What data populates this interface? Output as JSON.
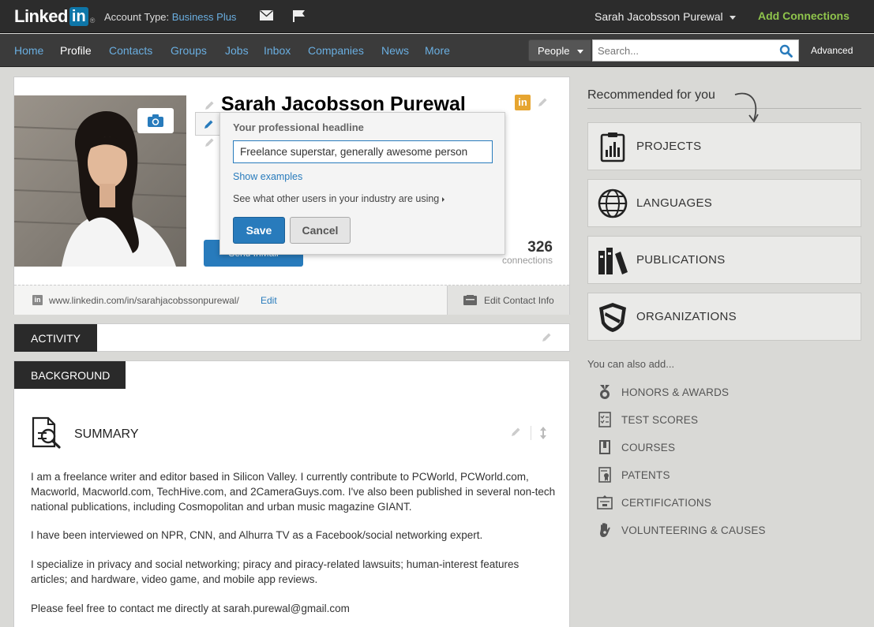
{
  "colors": {
    "link": "#287bbc",
    "nav_link": "#6aaee0",
    "add_connections": "#8fc44c",
    "topbar": "#2c2c2c"
  },
  "topbar": {
    "logo_text": "Linked",
    "logo_in": "in",
    "logo_reg": "®",
    "account_type_label": "Account Type:",
    "account_type_value": "Business Plus",
    "user_name": "Sarah Jacobsson Purewal",
    "add_connections": "Add Connections"
  },
  "nav": {
    "items": [
      "Home",
      "Profile",
      "Contacts",
      "Groups",
      "Jobs",
      "Inbox",
      "Companies",
      "News",
      "More"
    ],
    "active": "Profile",
    "search_scope": "People",
    "search_placeholder": "Search...",
    "advanced": "Advanced"
  },
  "profile": {
    "name": "Sarah Jacobsson Purewal",
    "li_badge": "in",
    "send_button": "Send InMail",
    "connections_count": "326",
    "connections_label": "connections",
    "public_url": "www.linkedin.com/in/sarahjacobssonpurewal/",
    "url_edit": "Edit",
    "edit_contact": "Edit Contact Info"
  },
  "headline_popover": {
    "title": "Your professional headline",
    "value": "Freelance superstar, generally awesome person",
    "show_examples": "Show examples",
    "others_link": "See what other users in your industry are using",
    "save": "Save",
    "cancel": "Cancel"
  },
  "sections": {
    "activity": "ACTIVITY",
    "background": "BACKGROUND",
    "summary_title": "SUMMARY",
    "summary_paragraphs": [
      "I am a freelance writer and editor based in Silicon Valley. I currently contribute to PCWorld, PCWorld.com, Macworld, Macworld.com, TechHive.com, and 2CameraGuys.com. I've also been published in several non-tech national publications, including Cosmopolitan and urban music magazine GIANT.",
      "I have been interviewed on NPR, CNN, and Alhurra TV as a Facebook/social networking expert.",
      "I specialize in privacy and social networking; piracy and piracy-related lawsuits; human-interest features articles; and hardware, video game, and mobile app reviews.",
      "Please feel free to contact me directly at sarah.purewal@gmail.com"
    ]
  },
  "recommended": {
    "title": "Recommended for you",
    "items": [
      {
        "label": "PROJECTS",
        "icon": "clipboard-chart-icon"
      },
      {
        "label": "LANGUAGES",
        "icon": "globe-icon"
      },
      {
        "label": "PUBLICATIONS",
        "icon": "books-icon"
      },
      {
        "label": "ORGANIZATIONS",
        "icon": "shield-icon"
      }
    ],
    "also_title": "You can also add...",
    "also_items": [
      {
        "label": "HONORS & AWARDS",
        "icon": "medal-icon"
      },
      {
        "label": "TEST SCORES",
        "icon": "checklist-icon"
      },
      {
        "label": "COURSES",
        "icon": "book-icon"
      },
      {
        "label": "PATENTS",
        "icon": "document-ribbon-icon"
      },
      {
        "label": "CERTIFICATIONS",
        "icon": "certificate-icon"
      },
      {
        "label": "VOLUNTEERING & CAUSES",
        "icon": "hand-icon"
      }
    ]
  }
}
